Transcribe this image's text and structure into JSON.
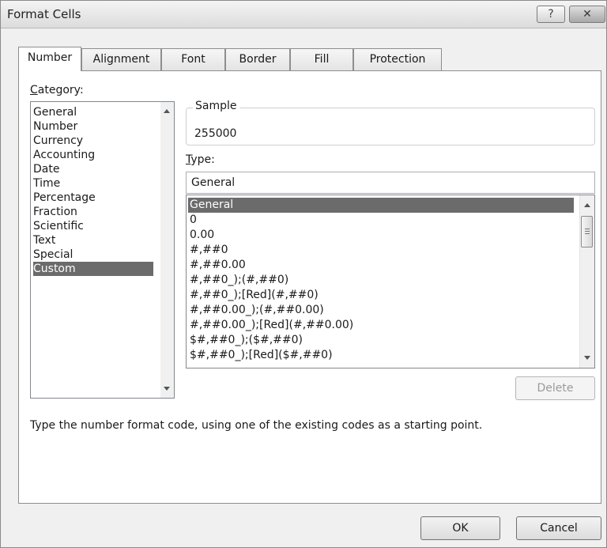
{
  "window": {
    "title": "Format Cells",
    "help_glyph": "?",
    "close_glyph": "✕"
  },
  "tabs": [
    {
      "label": "Number",
      "active": true
    },
    {
      "label": "Alignment"
    },
    {
      "label": "Font"
    },
    {
      "label": "Border"
    },
    {
      "label": "Fill"
    },
    {
      "label": "Protection"
    }
  ],
  "category": {
    "label_prefix": "C",
    "label_rest": "ategory:",
    "items": [
      "General",
      "Number",
      "Currency",
      "Accounting",
      "Date",
      "Time",
      "Percentage",
      "Fraction",
      "Scientific",
      "Text",
      "Special",
      "Custom"
    ],
    "selected": "Custom"
  },
  "sample": {
    "label": "Sample",
    "value": "255000"
  },
  "type": {
    "label_prefix": "T",
    "label_rest": "ype:",
    "value": "General",
    "items": [
      "General",
      "0",
      "0.00",
      "#,##0",
      "#,##0.00",
      "#,##0_);(#,##0)",
      "#,##0_);[Red](#,##0)",
      "#,##0.00_);(#,##0.00)",
      "#,##0.00_);[Red](#,##0.00)",
      "$#,##0_);($#,##0)",
      "$#,##0_);[Red]($#,##0)"
    ],
    "selected": "General"
  },
  "buttons": {
    "delete": "Delete",
    "ok": "OK",
    "cancel": "Cancel"
  },
  "description": "Type the number format code, using one of the existing codes as a starting point."
}
